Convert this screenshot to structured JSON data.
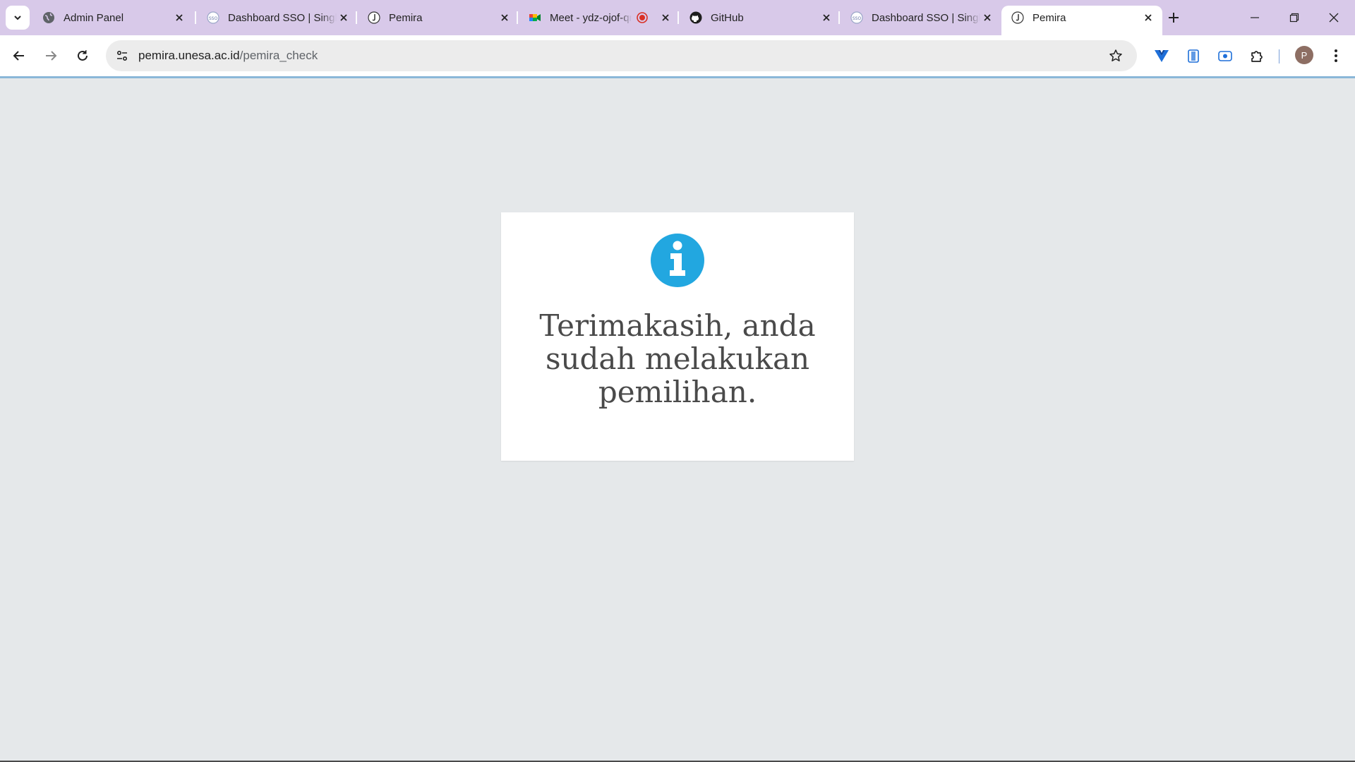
{
  "browser": {
    "tabs": [
      {
        "title": "Admin Panel",
        "favicon": "globe-icon",
        "active": false
      },
      {
        "title": "Dashboard SSO | Single",
        "favicon": "sso-icon",
        "active": false
      },
      {
        "title": "Pemira",
        "favicon": "pemira-icon",
        "active": false
      },
      {
        "title": "Meet - ydz-ojof-qnp",
        "favicon": "meet-icon",
        "active": false,
        "recording": true
      },
      {
        "title": "GitHub",
        "favicon": "github-icon",
        "active": false
      },
      {
        "title": "Dashboard SSO | Single",
        "favicon": "sso-icon",
        "active": false
      },
      {
        "title": "Pemira",
        "favicon": "pemira-icon",
        "active": true
      }
    ],
    "address": {
      "host": "pemira.unesa.ac.id",
      "path": "/pemira_check"
    },
    "profile_initial": "P",
    "colors": {
      "tabstrip": "#d8c9e9",
      "accent": "#1e88c8"
    }
  },
  "page": {
    "icon": "info-circle-icon",
    "icon_color": "#22a7e0",
    "message": "Terimakasih, anda sudah melakukan pemilihan."
  }
}
